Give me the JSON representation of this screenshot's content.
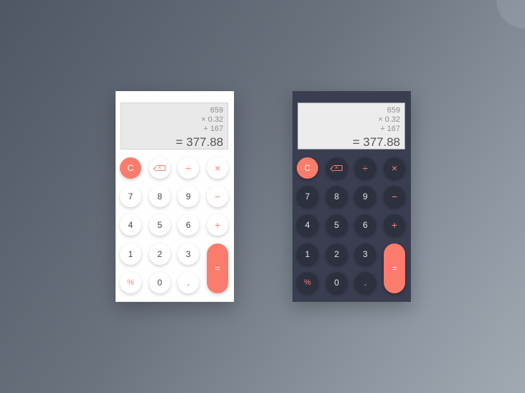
{
  "calculators": {
    "light": {
      "display": {
        "line1": "659",
        "line2": "× 0.32",
        "line3": "+ 167",
        "result": "= 377.88"
      },
      "keys": {
        "clear": "C",
        "divide": "÷",
        "multiply": "×",
        "seven": "7",
        "eight": "8",
        "nine": "9",
        "minus": "−",
        "four": "4",
        "five": "5",
        "six": "6",
        "plus": "+",
        "one": "1",
        "two": "2",
        "three": "3",
        "equals": "=",
        "percent": "%",
        "zero": "0",
        "decimal": ".",
        "backspace_icon": "backspace-icon"
      }
    },
    "dark": {
      "display": {
        "line1": "659",
        "line2": "× 0.32",
        "line3": "+ 167",
        "result": "= 377.88"
      },
      "keys": {
        "clear": "C",
        "divide": "÷",
        "multiply": "×",
        "seven": "7",
        "eight": "8",
        "nine": "9",
        "minus": "−",
        "four": "4",
        "five": "5",
        "six": "6",
        "plus": "+",
        "one": "1",
        "two": "2",
        "three": "3",
        "equals": "=",
        "percent": "%",
        "zero": "0",
        "decimal": ".",
        "backspace_icon": "backspace-icon"
      }
    }
  },
  "colors": {
    "accent": "#fb7c6c",
    "light_body": "#fefefe",
    "dark_body": "#3a3e50",
    "dark_key": "#2d303e",
    "display_bg": "#e9e9e9"
  }
}
